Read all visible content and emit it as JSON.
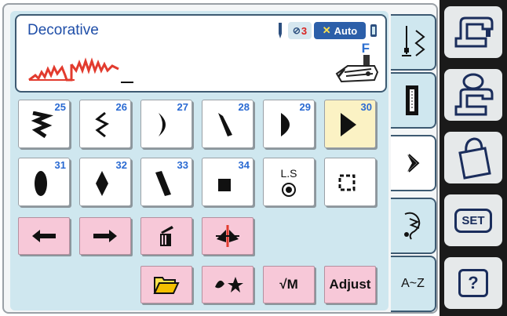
{
  "display": {
    "title": "Decorative",
    "auto_label": "Auto",
    "tension_value": "3",
    "presser_foot": "F"
  },
  "patterns": [
    {
      "number": "25",
      "icon": "zigzag-wave-icon",
      "selected": false
    },
    {
      "number": "26",
      "icon": "zigzag-small-icon",
      "selected": false
    },
    {
      "number": "27",
      "icon": "crescent-icon",
      "selected": false
    },
    {
      "number": "28",
      "icon": "slanted-leaf-icon",
      "selected": false
    },
    {
      "number": "29",
      "icon": "half-circle-icon",
      "selected": false
    },
    {
      "number": "30",
      "icon": "triangle-icon",
      "selected": true
    },
    {
      "number": "31",
      "icon": "oval-icon",
      "selected": false
    },
    {
      "number": "32",
      "icon": "diamond-icon",
      "selected": false
    },
    {
      "number": "33",
      "icon": "slanted-bar-icon",
      "selected": false
    },
    {
      "number": "34",
      "icon": "square-dot-icon",
      "selected": false
    }
  ],
  "ls_button": {
    "label": "L.S"
  },
  "actions": {
    "memory_label": "√M",
    "adjust_label": "Adjust"
  },
  "tabs": [
    {
      "name": "straight-stitch-tab",
      "icon": "utility-stitch-icon",
      "active": false
    },
    {
      "name": "buttonhole-tab",
      "icon": "buttonhole-icon",
      "active": false
    },
    {
      "name": "decorative-tab",
      "icon": "decorative-stitch-icon",
      "active": true
    },
    {
      "name": "applique-tab",
      "icon": "applique-icon",
      "active": false
    },
    {
      "name": "alphabet-tab",
      "label": "A~Z",
      "active": false
    }
  ],
  "hardware": {
    "set_label": "SET",
    "help_label": "?"
  },
  "colors": {
    "screen_bg": "#cfe7ef",
    "selected_bg": "#fbf2c4",
    "action_pink": "#f7c8d8",
    "number_blue": "#2a6ad2",
    "stitch_red": "#e23b2e"
  }
}
